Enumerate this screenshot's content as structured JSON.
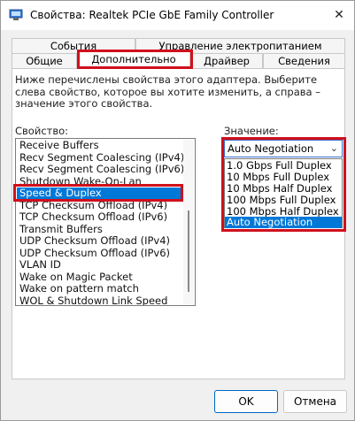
{
  "window": {
    "title": "Свойства: Realtek PCIe GbE Family Controller",
    "close_glyph": "✕"
  },
  "tabs": {
    "row_top": [
      "События",
      "Управление электропитанием"
    ],
    "row_bottom": [
      "Общие",
      "Дополнительно",
      "Драйвер",
      "Сведения"
    ],
    "active": "Дополнительно"
  },
  "description": "Ниже перечислены свойства этого адаптера. Выберите слева свойство, которое вы хотите изменить, а справа – значение этого свойства.",
  "property_label": "Свойство:",
  "value_label": "Значение:",
  "properties": [
    "Receive Buffers",
    "Recv Segment Coalescing (IPv4)",
    "Recv Segment Coalescing (IPv6)",
    "Shutdown Wake-On-Lan",
    "Speed & Duplex",
    "TCP Checksum Offload (IPv4)",
    "TCP Checksum Offload (IPv6)",
    "Transmit Buffers",
    "UDP Checksum Offload (IPv4)",
    "UDP Checksum Offload (IPv6)",
    "VLAN ID",
    "Wake on Magic Packet",
    "Wake on pattern match",
    "WOL & Shutdown Link Speed"
  ],
  "selected_property": "Speed & Duplex",
  "value": {
    "current": "Auto Negotiation",
    "options": [
      "1.0 Gbps Full Duplex",
      "10 Mbps Full Duplex",
      "10 Mbps Half Duplex",
      "100 Mbps Full Duplex",
      "100 Mbps Half Duplex",
      "Auto Negotiation"
    ]
  },
  "buttons": {
    "ok": "OK",
    "cancel": "Отмена"
  },
  "colors": {
    "highlight": "#d0101b",
    "selection": "#0078d7"
  }
}
